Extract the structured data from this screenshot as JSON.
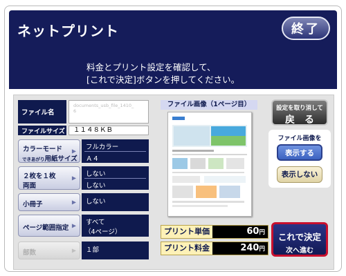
{
  "app": {
    "title": "ネットプリント",
    "end_label": "終了"
  },
  "instruction": {
    "line1": "料金とプリント設定を確認して、",
    "line2": "[これで決定]ボタンを押してください。"
  },
  "file": {
    "name_label": "ファイル名",
    "name_value_line1": "documents_usb_file_1410_",
    "name_value_line2": "6",
    "size_label": "ファイルサイズ",
    "size_value": "１１４８ＫＢ"
  },
  "settings": {
    "color_mode": {
      "label_line1": "カラーモード",
      "label_line2_small": "できあがり",
      "label_line2": "用紙サイズ",
      "value_line1": "フルカラー",
      "value_line2": "Ａ４"
    },
    "nup_duplex": {
      "label_line1": "２枚を１枚",
      "label_line2": "両面",
      "value_line1": "しない",
      "value_line2": "しない"
    },
    "booklet": {
      "label": "小冊子",
      "value": "しない"
    },
    "page_range": {
      "label": "ページ範囲指定",
      "value_line1": "すべて",
      "value_line2": "（4ページ）"
    },
    "copies": {
      "label": "部数",
      "value": "１部"
    }
  },
  "preview": {
    "caption": "ファイル画像（1ページ目）"
  },
  "sidebar": {
    "cancel_line1": "設定を取り消して",
    "cancel_line2": "戻　る",
    "file_image_label": "ファイル画像を",
    "show_label": "表示する",
    "hide_label": "表示しない"
  },
  "price": {
    "unit_label": "プリント単価",
    "unit_value": "60",
    "total_label": "プリント料金",
    "total_value": "240",
    "currency": "円"
  },
  "confirm": {
    "line1": "これで決定",
    "line2": "次へ進む"
  },
  "colors": {
    "navy": "#151c5a",
    "confirm_red": "#c8102e",
    "price_bg": "#fdf1b7"
  }
}
